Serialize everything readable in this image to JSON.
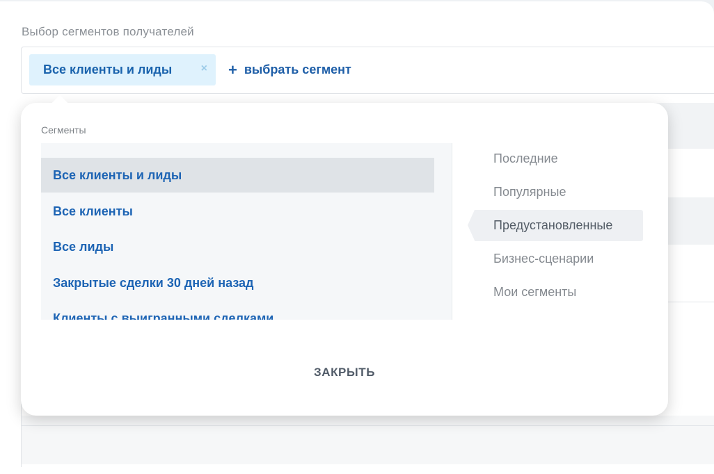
{
  "recipients": {
    "field_label": "Выбор сегментов получателей",
    "selected_chip": {
      "label": "Все клиенты и лиды",
      "close_glyph": "×"
    },
    "add_segment": {
      "plus": "+",
      "label": "выбрать сегмент"
    }
  },
  "popup": {
    "title": "Сегменты",
    "segments": [
      {
        "label": "Все клиенты и лиды",
        "selected": true
      },
      {
        "label": "Все клиенты",
        "selected": false
      },
      {
        "label": "Все лиды",
        "selected": false
      },
      {
        "label": "Закрытые сделки 30 дней назад",
        "selected": false
      },
      {
        "label": "Клиенты с выигранными сделками",
        "selected": false
      }
    ],
    "categories": [
      {
        "label": "Последние",
        "active": false
      },
      {
        "label": "Популярные",
        "active": false
      },
      {
        "label": "Предустановленные",
        "active": true
      },
      {
        "label": "Бизнес-сценарии",
        "active": false
      },
      {
        "label": "Мои сегменты",
        "active": false
      }
    ],
    "close_label": "ЗАКРЫТЬ"
  },
  "colors": {
    "accent": "#1d64b4",
    "chip_bg": "#dff2fd",
    "selected_row": "#dfe3e7",
    "muted_text": "#858a90"
  },
  "icons": {
    "chip_close": "close-icon",
    "add": "plus-icon"
  }
}
